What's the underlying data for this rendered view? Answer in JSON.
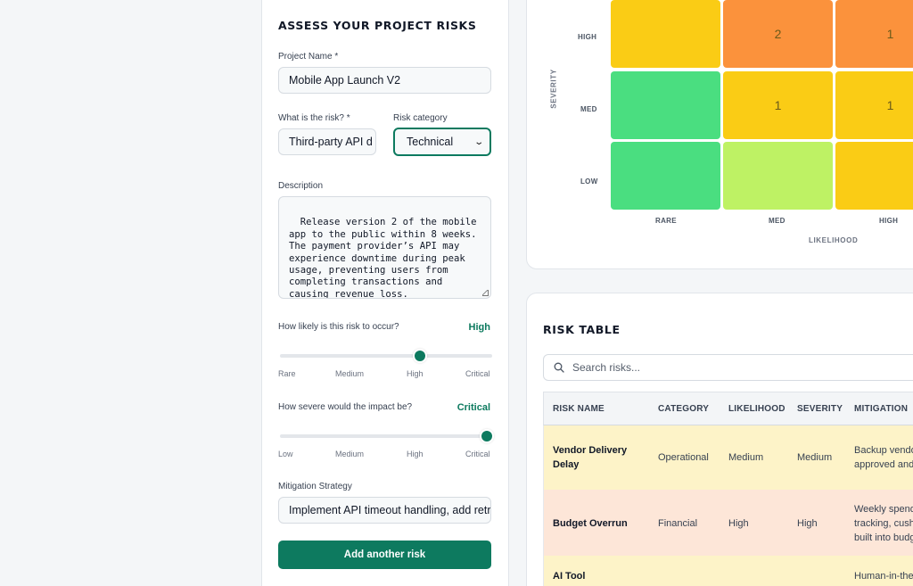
{
  "form": {
    "title": "ASSESS YOUR PROJECT RISKS",
    "project_name_label": "Project Name *",
    "project_name_value": "Mobile App Launch V2",
    "risk_label": "What is the risk? *",
    "risk_value": "Third-party API d",
    "category_label": "Risk category",
    "category_value": "Technical",
    "description_label": "Description",
    "description_value": "Release version 2 of the mobile\napp to the public within 8 weeks.\nThe payment provider’s API may\nexperience downtime during peak\nusage, preventing users from\ncompleting transactions and\ncausing revenue loss.",
    "likelihood_label": "How likely is this risk to occur?",
    "likelihood_value": "High",
    "likelihood_level": 0.667,
    "likelihood_ticks": [
      "Rare",
      "Medium",
      "High",
      "Critical"
    ],
    "severity_label": "How severe would the impact be?",
    "severity_value": "Critical",
    "severity_level": 1.0,
    "severity_ticks": [
      "Low",
      "Medium",
      "High",
      "Critical"
    ],
    "mitigation_label": "Mitigation Strategy",
    "mitigation_value": "Implement API timeout handling, add retry",
    "add_button": "Add another risk"
  },
  "matrix": {
    "severity_title": "SEVERITY",
    "likelihood_title": "LIKELIHOOD",
    "row_labels": [
      "HIGH",
      "MED",
      "LOW"
    ],
    "col_labels": [
      "RARE",
      "MED",
      "HIGH"
    ],
    "rows": [
      [
        {
          "count": "",
          "color": "#facc15"
        },
        {
          "count": "2",
          "color": "#fb923c"
        },
        {
          "count": "1",
          "color": "#fb923c"
        }
      ],
      [
        {
          "count": "",
          "color": "#4ade80"
        },
        {
          "count": "1",
          "color": "#facc15"
        },
        {
          "count": "1",
          "color": "#facc15"
        }
      ],
      [
        {
          "count": "",
          "color": "#4ade80"
        },
        {
          "count": "",
          "color": "#bef264"
        },
        {
          "count": "",
          "color": "#facc15"
        }
      ]
    ]
  },
  "table": {
    "title": "RISK TABLE",
    "search_placeholder": "Search risks...",
    "headers": [
      "RISK NAME",
      "CATEGORY",
      "LIKELIHOOD",
      "SEVERITY",
      "MITIGATION"
    ],
    "rows": [
      {
        "name": "Vendor Delivery\nDelay",
        "category": "Operational",
        "likelihood": "Medium",
        "severity": "Medium",
        "mitigation": "Backup vendo\napproved and",
        "bg": "#fdf3c8"
      },
      {
        "name": "Budget Overrun",
        "category": "Financial",
        "likelihood": "High",
        "severity": "High",
        "mitigation": "Weekly spend\ntracking, cush\nbuilt into budg",
        "bg": "#fde6d8"
      },
      {
        "name": "AI Tool",
        "category": "",
        "likelihood": "",
        "severity": "",
        "mitigation": "Human-in-the-",
        "bg": "#fdf3c8"
      }
    ]
  },
  "colors": {
    "accent": "#0d7a5f"
  }
}
